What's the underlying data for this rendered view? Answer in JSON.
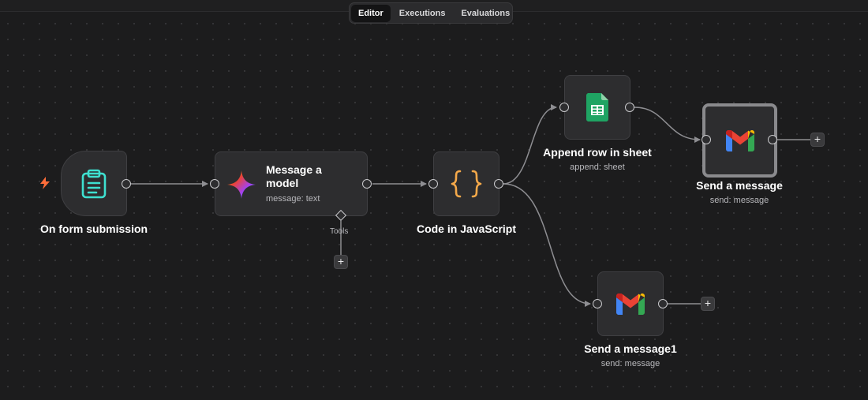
{
  "tabs": [
    {
      "label": "Editor",
      "active": true
    },
    {
      "label": "Executions",
      "active": false
    },
    {
      "label": "Evaluations",
      "active": false
    }
  ],
  "nodes": {
    "form": {
      "label": "On form submission",
      "icon": "clipboard-icon"
    },
    "model": {
      "label_line1": "Message a",
      "label_line2": "model",
      "subtitle": "message: text",
      "icon": "gemini-sparkle-icon"
    },
    "tools": {
      "label": "Tools"
    },
    "code": {
      "label": "Code in JavaScript",
      "icon": "braces-icon"
    },
    "sheet": {
      "label": "Append row in sheet",
      "subtitle": "append: sheet",
      "icon": "google-sheets-icon"
    },
    "gmail1": {
      "label": "Send a message",
      "subtitle": "send: message",
      "icon": "gmail-icon"
    },
    "gmail2": {
      "label": "Send a message1",
      "subtitle": "send: message",
      "icon": "gmail-icon"
    }
  },
  "plus_symbol": "+",
  "colors": {
    "canvas": "#1c1c1d",
    "node": "#2d2d2f",
    "trigger": "#ff6d3a",
    "clipboard": "#3ee0d0",
    "braces": "#f5a94a",
    "sheets": "#1fa463"
  }
}
